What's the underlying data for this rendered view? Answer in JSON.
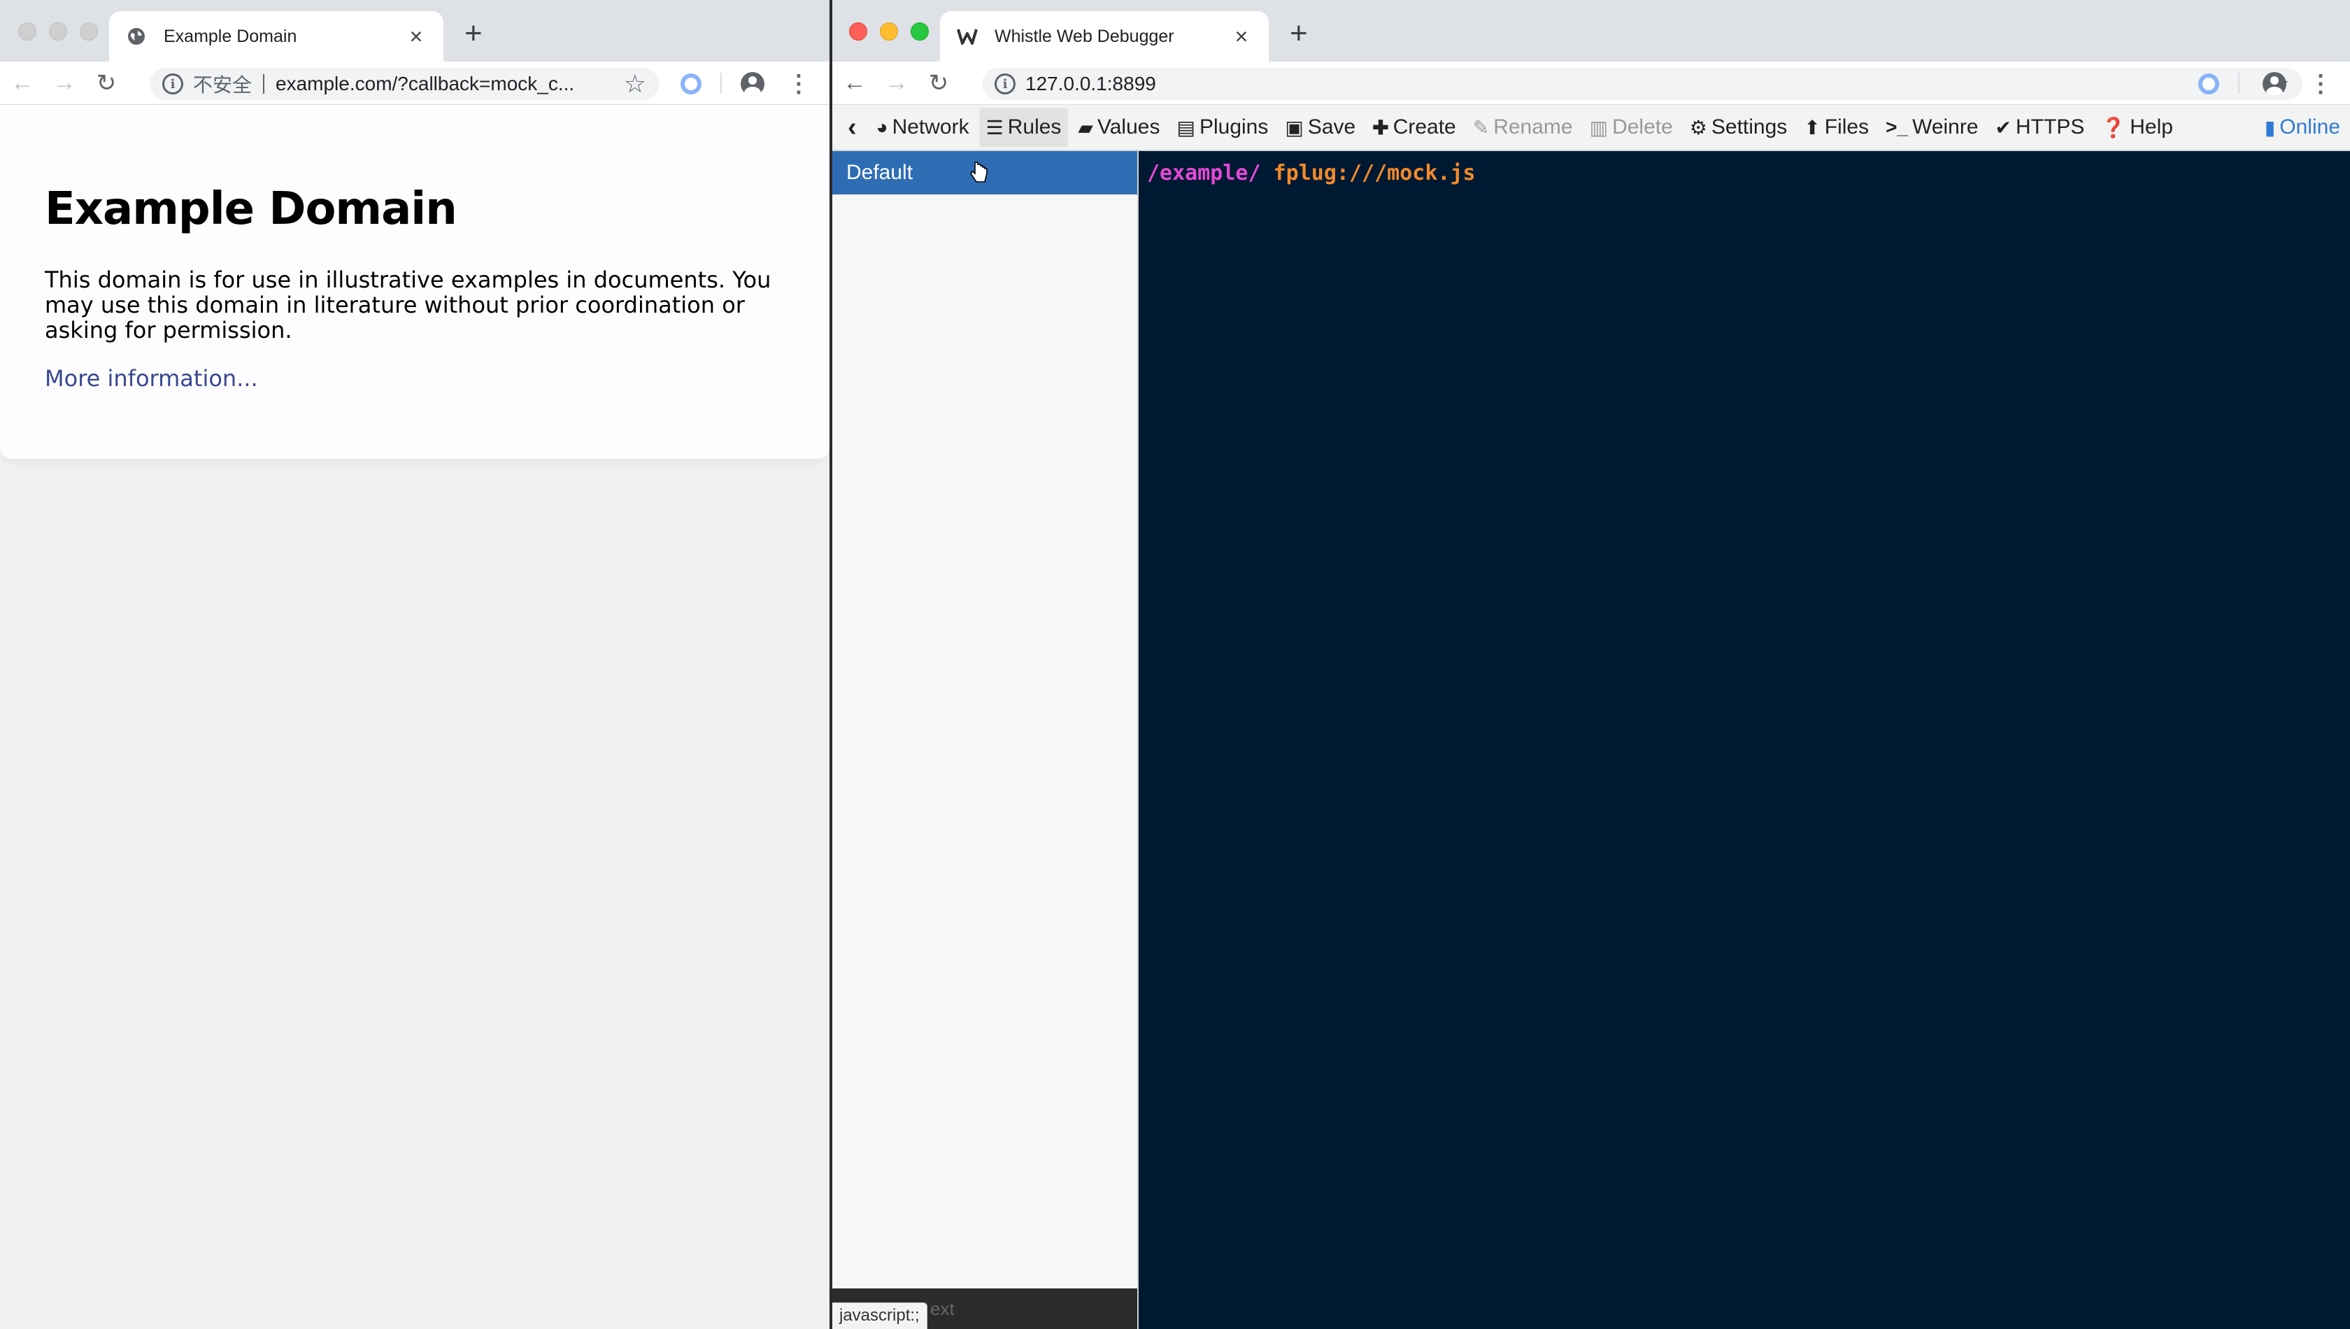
{
  "left_window": {
    "tab": {
      "title": "Example Domain"
    },
    "toolbar": {
      "security_label": "不安全",
      "url": "example.com/?callback=mock_c..."
    },
    "page": {
      "heading": "Example Domain",
      "paragraph": "This domain is for use in illustrative examples in documents. You may use this domain in literature without prior coordination or asking for permission.",
      "link": "More information..."
    }
  },
  "right_window": {
    "tab": {
      "title": "Whistle Web Debugger"
    },
    "toolbar": {
      "url": "127.0.0.1:8899"
    },
    "menu": {
      "back": "‹",
      "items": [
        {
          "label": "Network",
          "icon": "globe-icon"
        },
        {
          "label": "Rules",
          "icon": "list-icon",
          "active": true
        },
        {
          "label": "Values",
          "icon": "folder-icon"
        },
        {
          "label": "Plugins",
          "icon": "plugin-icon"
        },
        {
          "label": "Save",
          "icon": "save-icon"
        },
        {
          "label": "Create",
          "icon": "plus-icon"
        },
        {
          "label": "Rename",
          "icon": "edit-icon",
          "disabled": true
        },
        {
          "label": "Delete",
          "icon": "trash-icon",
          "disabled": true
        },
        {
          "label": "Settings",
          "icon": "gear-icon"
        },
        {
          "label": "Files",
          "icon": "upload-icon"
        },
        {
          "label": "Weinre",
          "icon": "console-icon"
        },
        {
          "label": "HTTPS",
          "icon": "check-icon"
        },
        {
          "label": "Help",
          "icon": "help-icon"
        }
      ],
      "online": "Online"
    },
    "sidebar": {
      "rules": [
        "Default"
      ],
      "filter_placeholder": "ext",
      "status_tip": "javascript:;"
    },
    "editor": {
      "line1_pattern": "/example/",
      "line1_operation": "fplug:///mock.js"
    }
  }
}
